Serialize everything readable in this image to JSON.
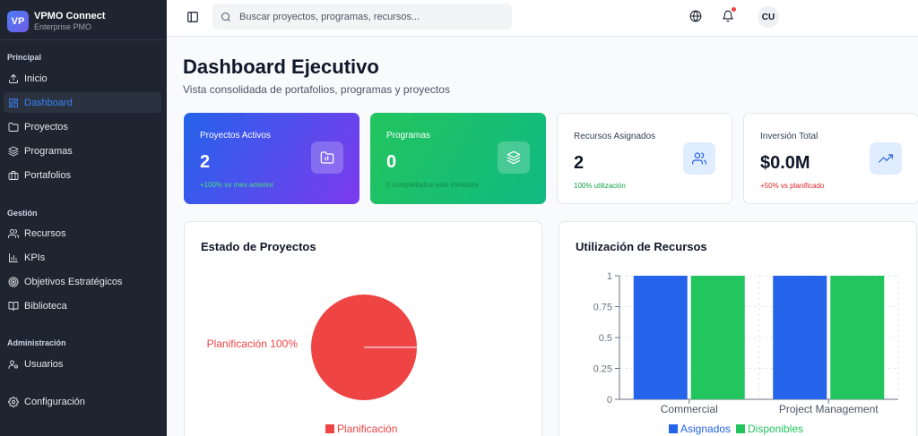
{
  "brand": {
    "logo": "VP",
    "name": "VPMO Connect",
    "subtitle": "Enterprise PMO"
  },
  "sidebar": {
    "sections": [
      {
        "title": "Principal"
      },
      {
        "title": "Gestión"
      },
      {
        "title": "Administración"
      }
    ],
    "items": [
      {
        "label": "Inicio",
        "icon": "upload-icon"
      },
      {
        "label": "Dashboard",
        "icon": "layout-icon",
        "active": true
      },
      {
        "label": "Proyectos",
        "icon": "folder-icon"
      },
      {
        "label": "Programas",
        "icon": "layers-icon"
      },
      {
        "label": "Portafolios",
        "icon": "briefcase-icon"
      },
      {
        "label": "Recursos",
        "icon": "users-icon"
      },
      {
        "label": "KPIs",
        "icon": "chart-icon"
      },
      {
        "label": "Objetivos Estratégicos",
        "icon": "target-icon"
      },
      {
        "label": "Biblioteca",
        "icon": "book-icon"
      },
      {
        "label": "Usuarios",
        "icon": "user-key-icon"
      },
      {
        "label": "Configuración",
        "icon": "gear-icon"
      }
    ]
  },
  "header": {
    "search_placeholder": "Buscar proyectos, programas, recursos...",
    "avatar_initials": "CU"
  },
  "page": {
    "title": "Dashboard Ejecutivo",
    "subtitle": "Vista consolidada de portafolios, programas y proyectos"
  },
  "cards": [
    {
      "label": "Proyectos Activos",
      "value": "2",
      "note": "+100% vs mes anterior",
      "icon": "folder-chart-icon"
    },
    {
      "label": "Programas",
      "value": "0",
      "note": "0 completados este trimestre",
      "icon": "layers-icon"
    },
    {
      "label": "Recursos Asignados",
      "value": "2",
      "note": "100% utilización",
      "icon": "users-icon"
    },
    {
      "label": "Inversión Total",
      "value": "$0.0M",
      "note": "+50% vs planificado",
      "icon": "trending-up-icon"
    }
  ],
  "panels": {
    "estado_title": "Estado de Proyectos",
    "utilizacion_title": "Utilización de Recursos"
  },
  "colors": {
    "accent": "#2563eb",
    "green": "#22c55e",
    "red": "#ef4444"
  },
  "chart_data": [
    {
      "type": "pie",
      "title": "Estado de Proyectos",
      "categories": [
        "Planificación"
      ],
      "values": [
        100
      ],
      "slice_labels": [
        "Planificación 100%"
      ],
      "legend": [
        "Planificación"
      ],
      "colors": [
        "#ef4444"
      ]
    },
    {
      "type": "bar",
      "title": "Utilización de Recursos",
      "categories": [
        "Commercial",
        "Project Management"
      ],
      "series": [
        {
          "name": "Asignados",
          "values": [
            1,
            1
          ],
          "color": "#2563eb"
        },
        {
          "name": "Disponibles",
          "values": [
            1,
            1
          ],
          "color": "#22c55e"
        }
      ],
      "yticks": [
        "0",
        "0.25",
        "0.5",
        "0.75",
        "1"
      ],
      "ylim": [
        0,
        1
      ],
      "grid": true,
      "legend_position": "bottom"
    }
  ]
}
